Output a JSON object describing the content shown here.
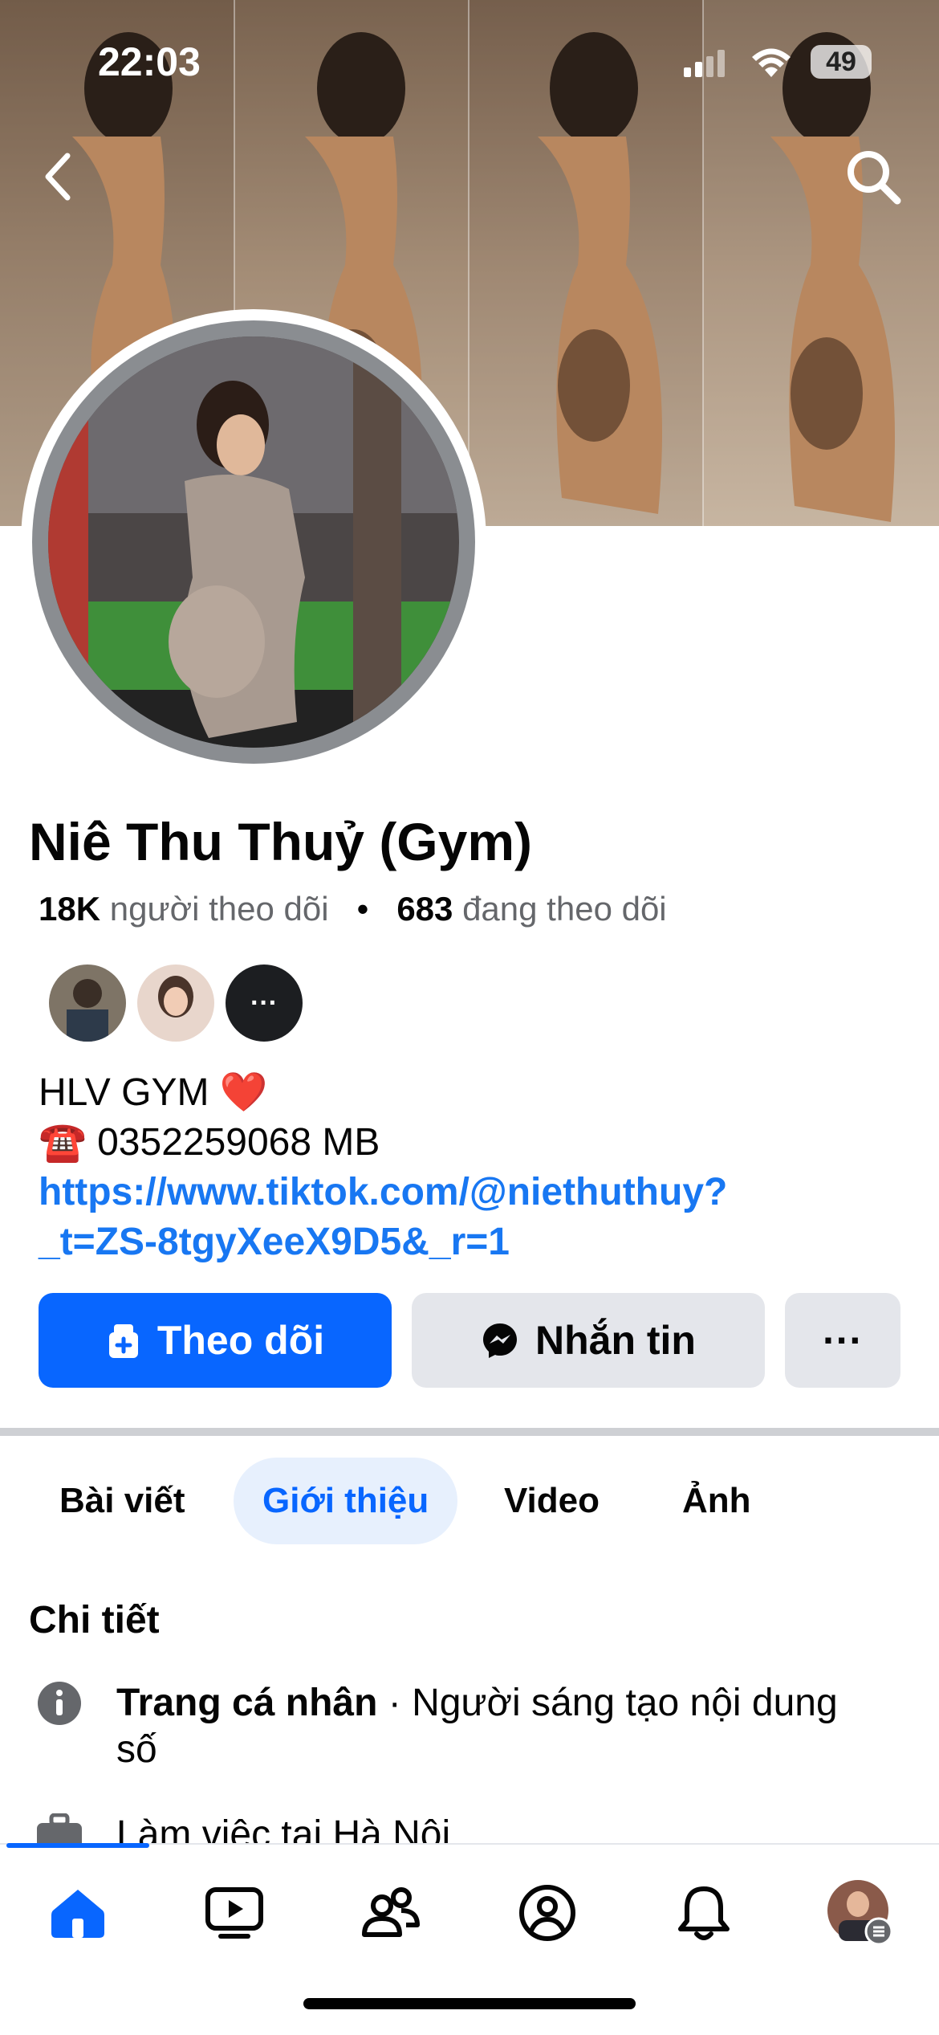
{
  "status_bar": {
    "time": "22:03",
    "battery": "49"
  },
  "profile": {
    "name": "Niê Thu Thuỷ (Gym)",
    "followers_count": "18K",
    "followers_label": "người theo dõi",
    "separator": "•",
    "following_count": "683",
    "following_label": "đang theo dõi",
    "more_mutuals": "···"
  },
  "bio": {
    "line1": "HLV GYM ❤️",
    "line2": "☎️ 0352259068 MB",
    "link_line1": "https://www.tiktok.com/@niethuthuy?",
    "link_line2": "_t=ZS-8tgyXeeX9D5&_r=1"
  },
  "actions": {
    "follow_label": "Theo dõi",
    "message_label": "Nhắn tin",
    "more_label": "···"
  },
  "tabs": [
    {
      "label": "Bài viết",
      "active": false
    },
    {
      "label": "Giới thiệu",
      "active": true
    },
    {
      "label": "Video",
      "active": false
    },
    {
      "label": "Ảnh",
      "active": false
    }
  ],
  "details": {
    "title": "Chi tiết",
    "page_type_bold": "Trang cá nhân",
    "page_type_rest": " · Người sáng tạo nội dung số",
    "work": "Làm việc tại Hà Nội"
  },
  "colors": {
    "accent": "#0866ff",
    "link": "#1877f2",
    "secondary_button": "#e4e6eb"
  },
  "icons": [
    "back-icon",
    "search-icon",
    "follow-icon",
    "messenger-icon",
    "info-icon",
    "briefcase-icon",
    "home-icon",
    "video-icon",
    "friends-icon",
    "profile-icon",
    "bell-icon"
  ]
}
